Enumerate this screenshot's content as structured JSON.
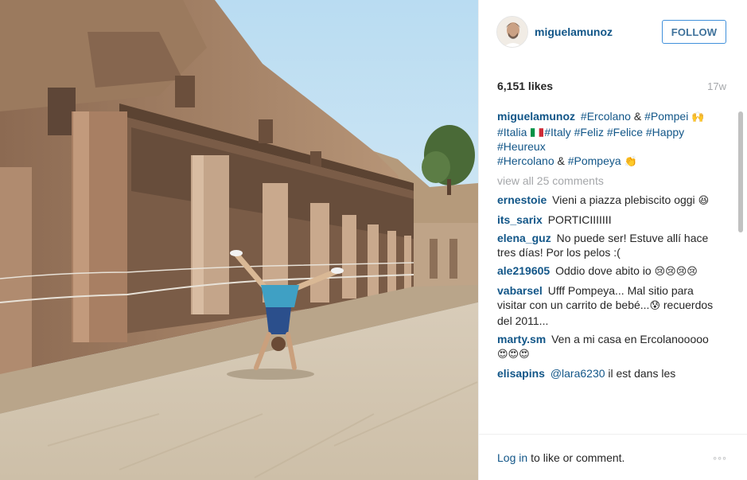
{
  "post": {
    "username": "miguelamunoz",
    "follow_label": "FOLLOW",
    "likes": "6,151 likes",
    "age": "17w",
    "caption": {
      "user": "miguelamunoz",
      "line1_tag1": "#Ercolano",
      "line1_amp": "&",
      "line1_tag2": "#Pompei",
      "line1_tail": "🙌",
      "line2_tag1": "#Italia",
      "line2_tag2": "#Italy",
      "line2_tag3": "#Feliz",
      "line2_tag4": "#Felice",
      "line2_tag5": "#Happy",
      "line3_tag1": "#Heureux",
      "line4_tag1": "#Hercolano",
      "line4_amp": "&",
      "line4_tag2": "#Pompeya",
      "line4_tail": "👏"
    },
    "view_all_label": "view all 25 comments",
    "comments": [
      {
        "user": "ernestoie",
        "text": "Vieni a piazza plebiscito oggi",
        "emoji": "😆"
      },
      {
        "user": "its_sarix",
        "text": "PORTICIIIIIII",
        "emoji": ""
      },
      {
        "user": "elena_guz",
        "text": "No puede ser! Estuve allí hace tres días! Por los pelos :(",
        "emoji": ""
      },
      {
        "user": "ale219605",
        "text": "Oddio dove abito io",
        "emoji": "😢😢😢😢"
      },
      {
        "user": "vabarsel",
        "text": "Ufff Pompeya... Mal sitio para visitar con un carrito de bebé...",
        "emoji": "😰",
        "tail": "recuerdos del 2011..."
      },
      {
        "user": "marty.sm",
        "text": "Ven a mi casa en Ercolanooooo",
        "emoji": "😍😍😍"
      },
      {
        "user": "elisapins",
        "mention": "@lara6230",
        "text": "il est dans les",
        "emoji": ""
      }
    ],
    "footer": {
      "login_label": "Log in",
      "text": "to like or comment.",
      "more_label": "◦◦◦"
    }
  },
  "colors": {
    "link": "#125688",
    "follow_border": "#4090db",
    "muted": "#a5a7aa"
  }
}
